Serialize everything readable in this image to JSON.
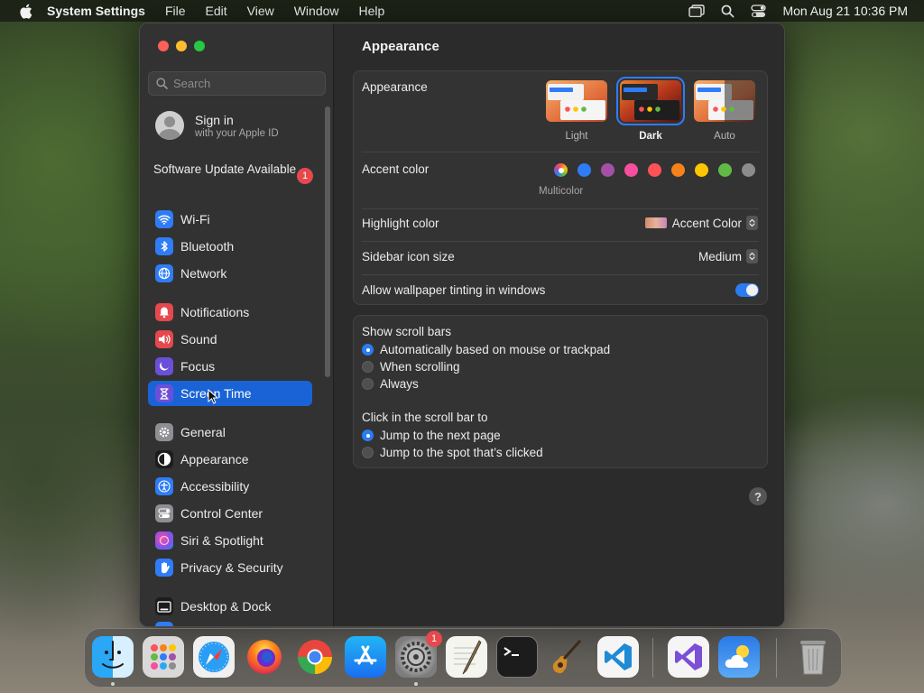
{
  "menubar": {
    "app_name": "System Settings",
    "menus": [
      "File",
      "Edit",
      "View",
      "Window",
      "Help"
    ],
    "clock": "Mon Aug 21  10:36 PM"
  },
  "sidebar": {
    "search_placeholder": "Search",
    "signin": {
      "title": "Sign in",
      "subtitle": "with your Apple ID"
    },
    "update": {
      "label": "Software Update Available",
      "badge": "1"
    },
    "items": [
      {
        "label": "Wi-Fi",
        "icon": "wifi-icon",
        "color": "#2f7cf6"
      },
      {
        "label": "Bluetooth",
        "icon": "bluetooth-icon",
        "color": "#2f7cf6"
      },
      {
        "label": "Network",
        "icon": "globe-icon",
        "color": "#2f7cf6"
      },
      {
        "label": "Notifications",
        "icon": "bell-icon",
        "color": "#e5484d"
      },
      {
        "label": "Sound",
        "icon": "speaker-icon",
        "color": "#e5484d"
      },
      {
        "label": "Focus",
        "icon": "moon-icon",
        "color": "#6b4fd8"
      },
      {
        "label": "Screen Time",
        "icon": "hourglass-icon",
        "color": "#6b4fd8",
        "selected": true
      },
      {
        "label": "General",
        "icon": "gear-icon",
        "color": "#8e8e93"
      },
      {
        "label": "Appearance",
        "icon": "appearance-icon",
        "color": "#1c1c1c"
      },
      {
        "label": "Accessibility",
        "icon": "accessibility-icon",
        "color": "#2f7cf6"
      },
      {
        "label": "Control Center",
        "icon": "control-center-icon",
        "color": "#8e8e93"
      },
      {
        "label": "Siri & Spotlight",
        "icon": "siri-icon",
        "color": "#b04fd8"
      },
      {
        "label": "Privacy & Security",
        "icon": "hand-icon",
        "color": "#2f7cf6"
      },
      {
        "label": "Desktop & Dock",
        "icon": "desktop-icon",
        "color": "#1c1c1c"
      }
    ]
  },
  "content": {
    "title": "Appearance",
    "appearance": {
      "label": "Appearance",
      "options": [
        {
          "label": "Light",
          "selected": false
        },
        {
          "label": "Dark",
          "selected": true
        },
        {
          "label": "Auto",
          "selected": false
        }
      ]
    },
    "accent": {
      "label": "Accent color",
      "selected_label": "Multicolor",
      "colors": [
        "multicolor",
        "#2f7cf6",
        "#a550a7",
        "#f74f9e",
        "#ff5257",
        "#f7821b",
        "#ffc600",
        "#62ba46",
        "#8c8c8c"
      ]
    },
    "highlight": {
      "label": "Highlight color",
      "value": "Accent Color"
    },
    "sidebar_icon": {
      "label": "Sidebar icon size",
      "value": "Medium"
    },
    "tinting": {
      "label": "Allow wallpaper tinting in windows",
      "on": true
    },
    "scrollbars": {
      "label": "Show scroll bars",
      "options": [
        {
          "label": "Automatically based on mouse or trackpad",
          "selected": true
        },
        {
          "label": "When scrolling",
          "selected": false
        },
        {
          "label": "Always",
          "selected": false
        }
      ]
    },
    "click_scroll": {
      "label": "Click in the scroll bar to",
      "options": [
        {
          "label": "Jump to the next page",
          "selected": true
        },
        {
          "label": "Jump to the spot that’s clicked",
          "selected": false
        }
      ]
    },
    "help": "?"
  },
  "dock": {
    "apps": [
      {
        "name": "finder-icon",
        "running": true
      },
      {
        "name": "launchpad-icon",
        "running": false
      },
      {
        "name": "safari-icon",
        "running": false
      },
      {
        "name": "firefox-icon",
        "running": false
      },
      {
        "name": "chrome-icon",
        "running": false
      },
      {
        "name": "app-store-icon",
        "running": false
      },
      {
        "name": "system-settings-icon",
        "running": true,
        "badge": "1"
      },
      {
        "name": "textedit-icon",
        "running": false
      },
      {
        "name": "terminal-icon",
        "running": false
      },
      {
        "name": "garageband-icon",
        "running": false
      },
      {
        "name": "vscode-icon",
        "running": false
      },
      {
        "name": "visual-studio-icon",
        "running": false
      },
      {
        "name": "weather-icon",
        "running": false
      },
      {
        "name": "trash-icon",
        "running": false
      }
    ]
  }
}
